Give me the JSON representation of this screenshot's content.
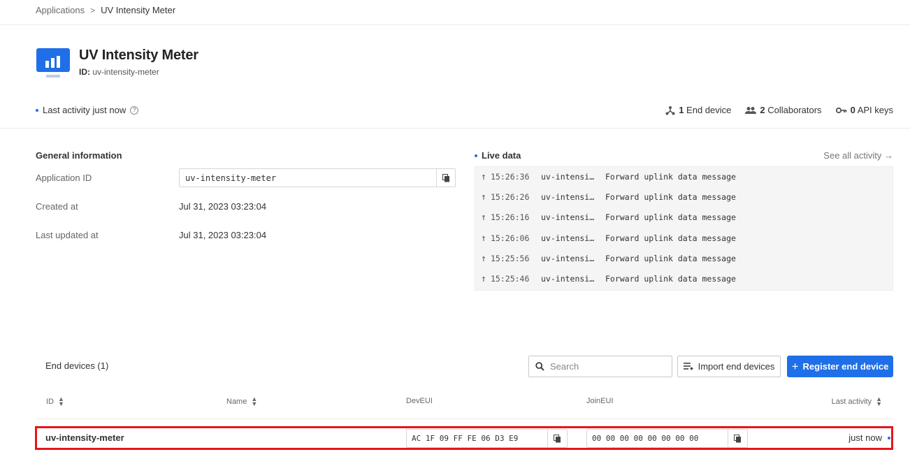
{
  "breadcrumb": {
    "root": "Applications",
    "separator": ">",
    "current": "UV Intensity Meter"
  },
  "app": {
    "title": "UV Intensity Meter",
    "id_label": "ID:",
    "id_value": "uv-intensity-meter"
  },
  "status": {
    "last_activity": "Last activity just now"
  },
  "counts": {
    "end_devices_num": "1",
    "end_devices_label": "End device",
    "collaborators_num": "2",
    "collaborators_label": "Collaborators",
    "api_keys_num": "0",
    "api_keys_label": "API keys"
  },
  "general": {
    "title": "General information",
    "application_id_label": "Application ID",
    "application_id_value": "uv-intensity-meter",
    "created_label": "Created at",
    "created_value": "Jul 31, 2023 03:23:04",
    "updated_label": "Last updated at",
    "updated_value": "Jul 31, 2023 03:23:04"
  },
  "live": {
    "title": "Live data",
    "see_all": "See all activity →",
    "rows": [
      {
        "time": "15:26:36",
        "device": "uv-intensi…",
        "message": "Forward uplink data message"
      },
      {
        "time": "15:26:26",
        "device": "uv-intensi…",
        "message": "Forward uplink data message"
      },
      {
        "time": "15:26:16",
        "device": "uv-intensi…",
        "message": "Forward uplink data message"
      },
      {
        "time": "15:26:06",
        "device": "uv-intensi…",
        "message": "Forward uplink data message"
      },
      {
        "time": "15:25:56",
        "device": "uv-intensi…",
        "message": "Forward uplink data message"
      },
      {
        "time": "15:25:46",
        "device": "uv-intensi…",
        "message": "Forward uplink data message"
      }
    ]
  },
  "end_devices": {
    "title": "End devices (1)",
    "search_placeholder": "Search",
    "import_label": "Import end devices",
    "register_label": "Register end device",
    "columns": {
      "id": "ID",
      "name": "Name",
      "dev_eui": "DevEUI",
      "join_eui": "JoinEUI",
      "last_activity": "Last activity"
    },
    "rows": [
      {
        "id": "uv-intensity-meter",
        "name": "",
        "dev_eui": "AC 1F 09 FF FE 06 D3 E9",
        "join_eui": "00 00 00 00 00 00 00 00",
        "last_activity": "just now"
      }
    ]
  },
  "colors": {
    "accent": "#1f6fe8",
    "highlight": "#e8141a"
  }
}
